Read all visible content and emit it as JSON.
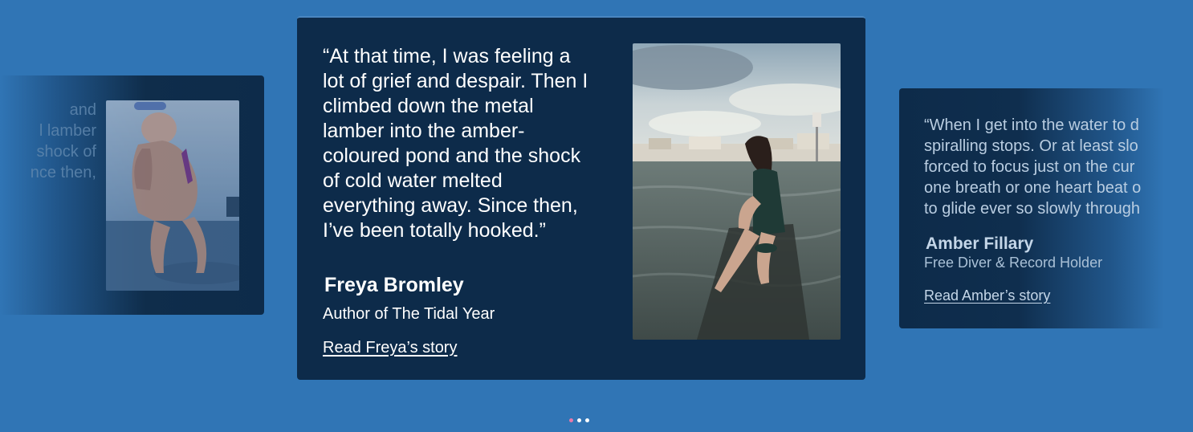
{
  "carousel": {
    "slides": [
      {
        "quote_fragment": "and\nl lamber\n shock of\nnce then,",
        "photo": "woman-splashing-face-photo"
      },
      {
        "quote": "“At that time, I was feeling a\nlot of grief and despair. Then I\nclimbed down the metal\nlamber into the amber-\ncoloured pond and the shock\nof cold water melted\neverything away. Since then,\nI’ve been totally hooked.”",
        "name": "Freya Bromley",
        "role": "Author of The Tidal Year",
        "link_label": "Read Freya’s story",
        "photo": "woman-seated-on-sea-wall-photo"
      },
      {
        "quote": "“When I get into the water to d\nspiralling stops. Or at least slo\nforced to focus just on the cur\none breath or one heart beat o\nto glide ever so slowly through",
        "name": "Amber Fillary",
        "role": "Free Diver & Record Holder",
        "link_label": "Read Amber’s story"
      }
    ],
    "active_index": 1,
    "pagination_count": 3
  },
  "colors": {
    "background": "#3075b5",
    "card": "#0d2b4a",
    "active_dot": "#e879a9",
    "dot": "#ffffff"
  }
}
